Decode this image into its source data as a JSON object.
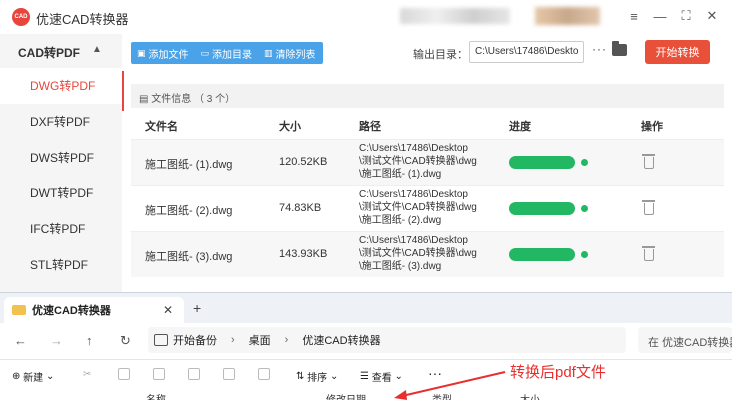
{
  "app": {
    "title": "优速CAD转换器",
    "logo_text": "CAD",
    "window_controls": {
      "menu": "≡",
      "minimize": "—",
      "maximize": "⛶",
      "close": "✕"
    },
    "sidebar": {
      "header": "CAD转PDF",
      "items": [
        {
          "label": "DWG转PDF",
          "active": true
        },
        {
          "label": "DXF转PDF",
          "active": false
        },
        {
          "label": "DWS转PDF",
          "active": false
        },
        {
          "label": "DWT转PDF",
          "active": false
        },
        {
          "label": "IFC转PDF",
          "active": false
        },
        {
          "label": "STL转PDF",
          "active": false
        }
      ]
    },
    "toolbar": {
      "add_file": "添加文件",
      "add_dir": "添加目录",
      "clear_list": "清除列表",
      "output_label": "输出目录：",
      "output_path": "C:\\Users\\17486\\Deskto",
      "browse": "···",
      "start": "开始转换"
    },
    "file_info": "文件信息 （ 3 个）",
    "table": {
      "headers": {
        "name": "文件名",
        "size": "大小",
        "path": "路径",
        "progress": "进度",
        "action": "操作"
      },
      "rows": [
        {
          "name": "施工图纸- (1).dwg",
          "size": "120.52KB",
          "path": [
            "C:\\Users\\17486\\Desktop",
            "\\测试文件\\CAD转换器\\dwg",
            "\\施工图纸- (1).dwg"
          ],
          "progress": 100
        },
        {
          "name": "施工图纸- (2).dwg",
          "size": "74.83KB",
          "path": [
            "C:\\Users\\17486\\Desktop",
            "\\测试文件\\CAD转换器\\dwg",
            "\\施工图纸- (2).dwg"
          ],
          "progress": 100
        },
        {
          "name": "施工图纸- (3).dwg",
          "size": "143.93KB",
          "path": [
            "C:\\Users\\17486\\Desktop",
            "\\测试文件\\CAD转换器\\dwg",
            "\\施工图纸- (3).dwg"
          ],
          "progress": 100
        }
      ]
    },
    "colors": {
      "accent": "#e8453c",
      "toolbar_blue": "#4aa3e8",
      "progress_green": "#22b863",
      "start_button": "#e8503a"
    }
  },
  "explorer": {
    "tab_title": "优速CAD转换器",
    "tab_close": "✕",
    "tab_new": "+",
    "nav": {
      "back": "←",
      "forward": "→",
      "up": "↑",
      "refresh": "↻"
    },
    "breadcrumb": [
      "开始备份",
      "桌面",
      "优速CAD转换器"
    ],
    "breadcrumb_sep": "›",
    "search_placeholder": "在 优速CAD转换器 中搜索",
    "commands": {
      "new": "新建",
      "sort": "排序",
      "view": "查看",
      "more": "···"
    },
    "columns": [
      "名称",
      "修改日期",
      "类型",
      "大小"
    ]
  },
  "annotation": "转换后pdf文件"
}
